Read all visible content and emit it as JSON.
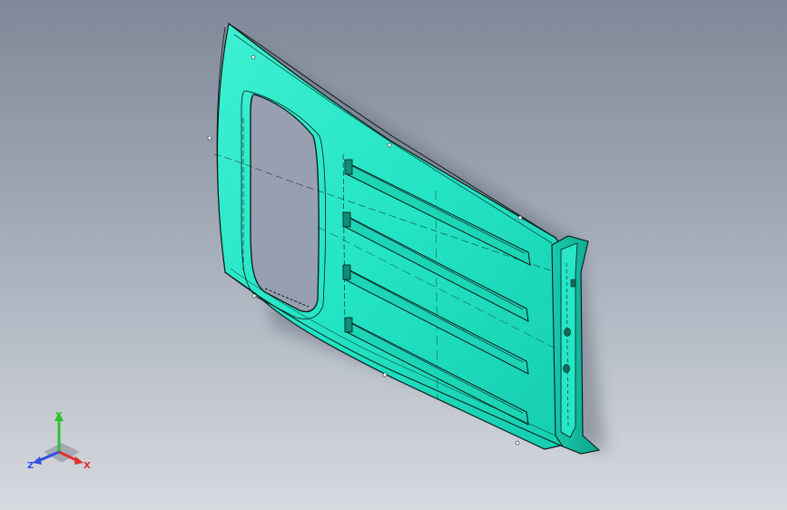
{
  "viewport": {
    "background_top": "#7f8898",
    "background_bottom": "#d7dadf"
  },
  "model": {
    "part_color": "#27e6c6",
    "edge_color": "#0a1a18"
  },
  "triad": {
    "x_label": "X",
    "y_label": "Y",
    "z_label": "Z",
    "x_color": "#e03030",
    "y_color": "#30c030",
    "z_color": "#3050e0"
  }
}
